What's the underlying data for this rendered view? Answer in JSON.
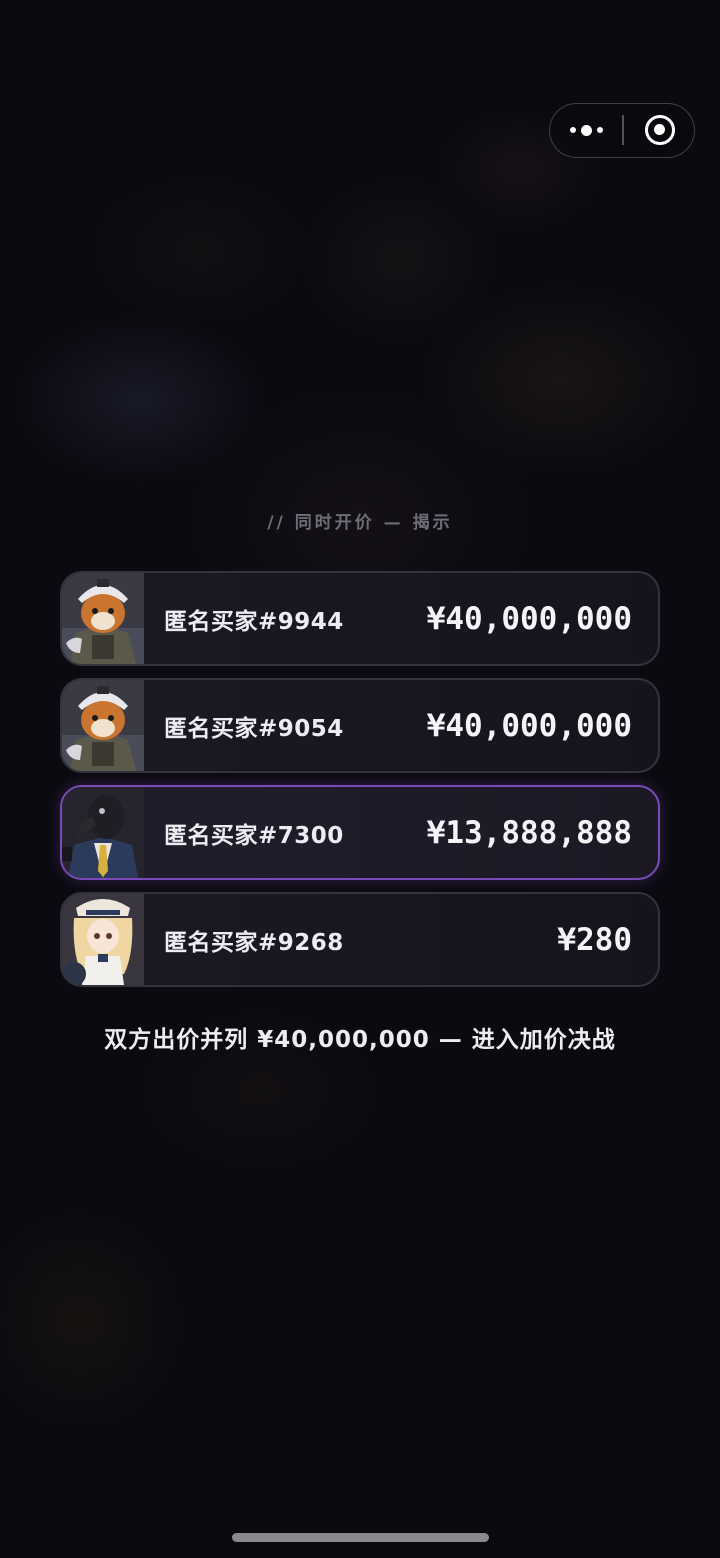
{
  "capsule": {
    "more_icon": "more-dots-icon",
    "close_icon": "target-close-icon"
  },
  "section_label": "// 同时开价 — 揭示",
  "bids": [
    {
      "avatar": "fox-pilot-avatar",
      "name": "匿名买家#9944",
      "price": "¥40,000,000",
      "highlighted": false
    },
    {
      "avatar": "fox-pilot-avatar",
      "name": "匿名买家#9054",
      "price": "¥40,000,000",
      "highlighted": false
    },
    {
      "avatar": "bird-suit-avatar",
      "name": "匿名买家#7300",
      "price": "¥13,888,888",
      "highlighted": true
    },
    {
      "avatar": "anime-girl-avatar",
      "name": "匿名买家#9268",
      "price": "¥280",
      "highlighted": false
    }
  ],
  "result_text": "双方出价并列 ¥40,000,000 — 进入加价决战",
  "colors": {
    "highlight_border": "#7a4ab8",
    "row_border": "#34333d",
    "label_gray": "#6f6d78"
  }
}
